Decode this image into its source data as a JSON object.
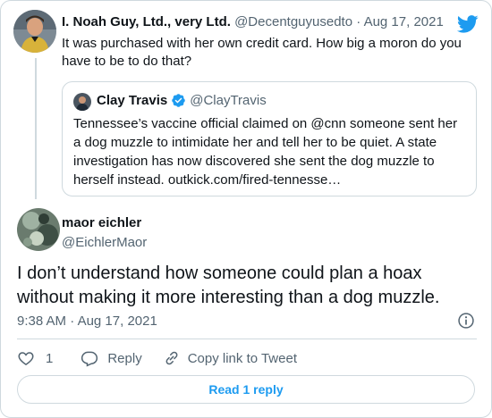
{
  "parent_tweet": {
    "display_name": "I. Noah Guy, Ltd., very Ltd.",
    "handle": "@Decentguyusedto",
    "separator": "·",
    "date": "Aug 17, 2021",
    "text": "It was purchased with her own credit card. How big a moron do you have to be to do that?"
  },
  "quoted_tweet": {
    "display_name": "Clay Travis",
    "handle": "@ClayTravis",
    "verified": true,
    "text": "Tennessee’s vaccine official claimed on @cnn someone sent her a dog muzzle to intimidate her and tell her to be quiet. A state investigation has now discovered she sent the dog muzzle to herself instead. outkick.com/fired-tennesse…"
  },
  "main_tweet": {
    "display_name": "maor eichler",
    "handle": "@EichlerMaor",
    "text": "I don’t understand how someone could plan a hoax without making it more interesting than a dog muzzle.",
    "time": "9:38 AM",
    "separator": "·",
    "date": "Aug 17, 2021"
  },
  "actions": {
    "like_count": "1",
    "reply_label": "Reply",
    "copy_link_label": "Copy link to Tweet"
  },
  "read_replies_label": "Read 1 reply",
  "colors": {
    "twitter_blue": "#1d9bf0",
    "text_primary": "#0f1419",
    "text_secondary": "#536471",
    "border": "#cfd9de"
  },
  "icons": [
    "twitter-bird-icon",
    "verified-badge-icon",
    "info-icon",
    "heart-icon",
    "reply-icon",
    "link-icon"
  ]
}
